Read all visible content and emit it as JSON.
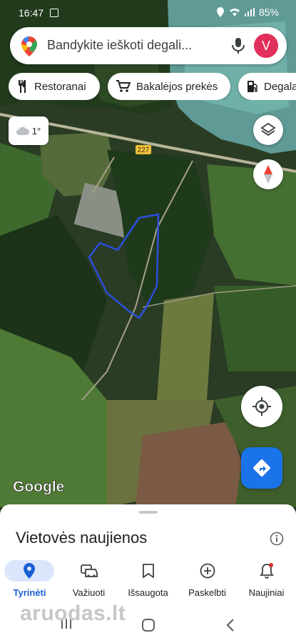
{
  "status_bar": {
    "time": "16:47",
    "battery": "85%"
  },
  "search": {
    "placeholder": "Bandykite ieškoti degali...",
    "avatar_letter": "V"
  },
  "chips": [
    {
      "label": "Restoranai",
      "icon": "restaurant-icon"
    },
    {
      "label": "Bakalėjos prekės",
      "icon": "cart-icon"
    },
    {
      "label": "Degala",
      "icon": "gas-station-icon"
    }
  ],
  "weather": {
    "temp": "1°",
    "icon": "cloud-icon"
  },
  "map": {
    "road_label": "227",
    "attribution": "Google"
  },
  "sheet": {
    "title": "Vietovės naujienos"
  },
  "bottom_nav": [
    {
      "label": "Tyrinėti",
      "icon": "location-pin-icon",
      "active": true
    },
    {
      "label": "Važiuoti",
      "icon": "car-icon"
    },
    {
      "label": "Išsaugota",
      "icon": "bookmark-icon"
    },
    {
      "label": "Paskelbti",
      "icon": "add-circle-icon"
    },
    {
      "label": "Naujiniai",
      "icon": "bell-icon"
    }
  ],
  "watermark": "aruodas.lt",
  "colors": {
    "accent": "#1a73e8",
    "polygon": "#2b4fe0",
    "avatar": "#e0305b"
  }
}
